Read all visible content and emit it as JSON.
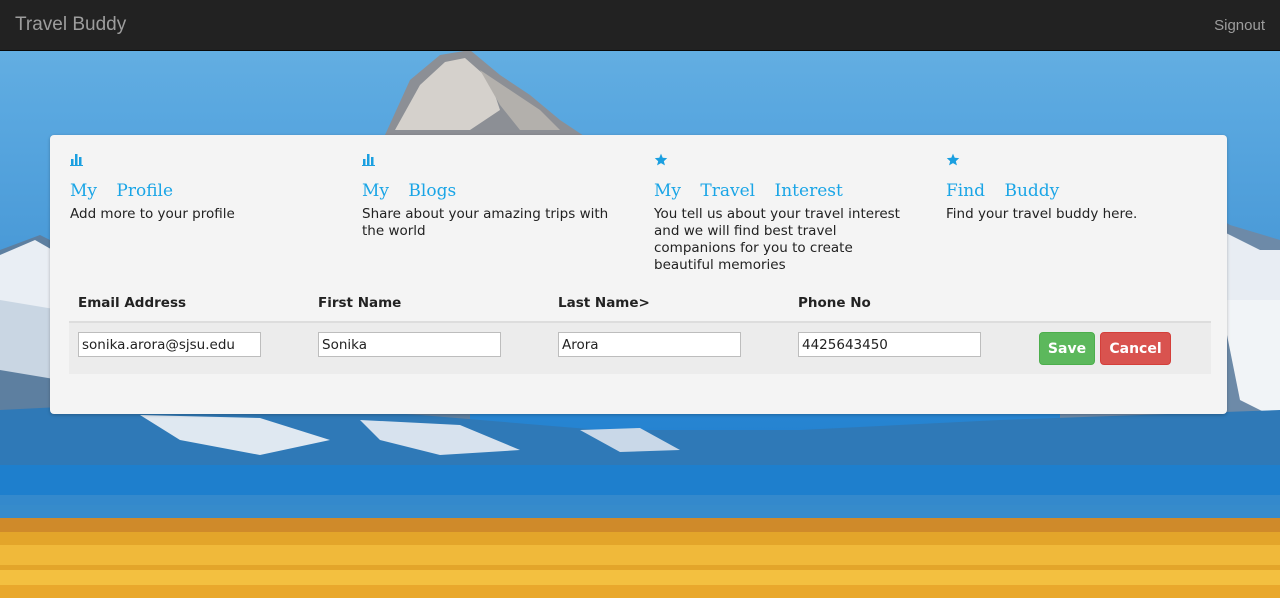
{
  "navbar": {
    "brand": "Travel Buddy",
    "signout": "Signout"
  },
  "features": [
    {
      "icon": "bar-chart-icon",
      "title": "My Profile",
      "desc": "Add more to your profile"
    },
    {
      "icon": "bar-chart-icon",
      "title": "My Blogs",
      "desc": "Share about your amazing trips with the world"
    },
    {
      "icon": "star-icon",
      "title": "My Travel Interest",
      "desc": "You tell us about your travel interest and we will find best travel companions for you to create beautiful memories"
    },
    {
      "icon": "star-icon",
      "title": "Find Buddy",
      "desc": "Find your travel buddy here."
    }
  ],
  "profile_table": {
    "headers": {
      "email": "Email Address",
      "first_name": "First Name",
      "last_name": "Last Name>",
      "phone": "Phone No"
    },
    "values": {
      "email": "sonika.arora@sjsu.edu",
      "first_name": "Sonika",
      "last_name": "Arora",
      "phone": "4425643450"
    },
    "save_label": "Save",
    "cancel_label": "Cancel"
  },
  "colors": {
    "navbar_bg": "#222222",
    "link_blue": "#1aa5e6",
    "save_green": "#5cb85c",
    "cancel_red": "#d9534f"
  }
}
